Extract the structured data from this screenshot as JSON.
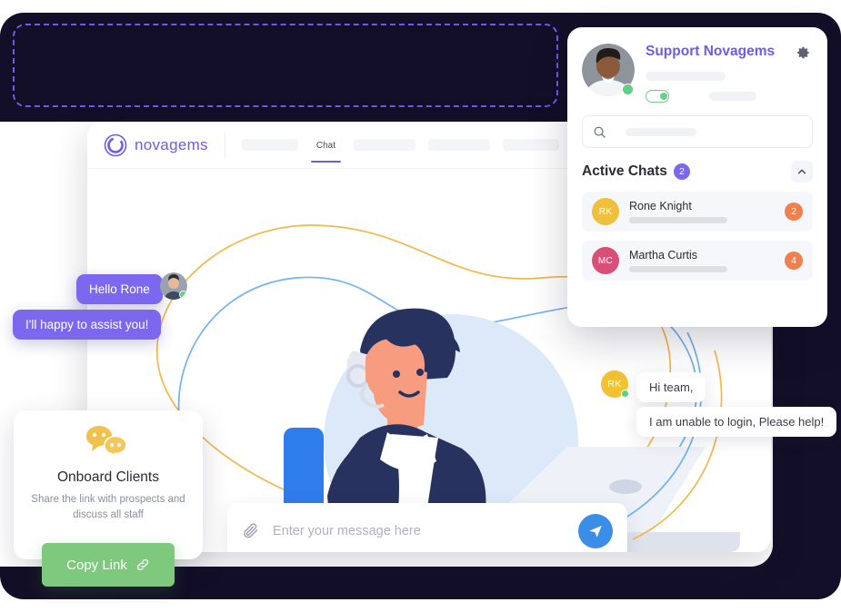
{
  "app": {
    "logo_text": "novagems",
    "nav": {
      "active_tab": "Chat",
      "placeholder_widths": [
        62,
        68,
        68,
        62,
        62
      ]
    }
  },
  "chat": {
    "outgoing": [
      {
        "text": "Hello Rone"
      },
      {
        "text": "I'll happy to assist you!"
      }
    ],
    "incoming": [
      {
        "text": "Hi team,"
      },
      {
        "text": "I am unable to login, Please help!"
      }
    ],
    "incoming_avatar_initials": "RK",
    "input": {
      "value": "",
      "placeholder": "Enter your message here",
      "attach_icon": "paperclip-icon",
      "send_icon": "send-paper-plane-icon"
    }
  },
  "onboard_card": {
    "icon": "chat-bubbles-icon",
    "title": "Onboard Clients",
    "subtitle": "Share the link with prospects and discuss all staff",
    "button_label": "Copy Link",
    "button_icon": "link-icon",
    "button_color": "#7ec97e"
  },
  "widget": {
    "title": "Support Novagems",
    "gear_icon": "gear-icon",
    "status_toggle_on": true,
    "search": {
      "value": "",
      "placeholder": "",
      "icon": "search-icon"
    },
    "active_chats": {
      "label": "Active Chats",
      "count": "2",
      "collapse_icon": "chevron-up-icon"
    },
    "items": [
      {
        "initials": "RK",
        "name": "Rone Knight",
        "badge": "2",
        "avatar_color": "#f0c03c",
        "badge_color": "#f0804f"
      },
      {
        "initials": "MC",
        "name": "Martha Curtis",
        "badge": "4",
        "avatar_color": "#d94f77",
        "badge_color": "#f0804f"
      }
    ]
  },
  "theme": {
    "accent_purple": "#6c5ce7",
    "bubble_purple": "#7b68ee",
    "send_blue": "#3b8ee8",
    "dark_bg": "#140f28",
    "online_green": "#5fcf80"
  }
}
